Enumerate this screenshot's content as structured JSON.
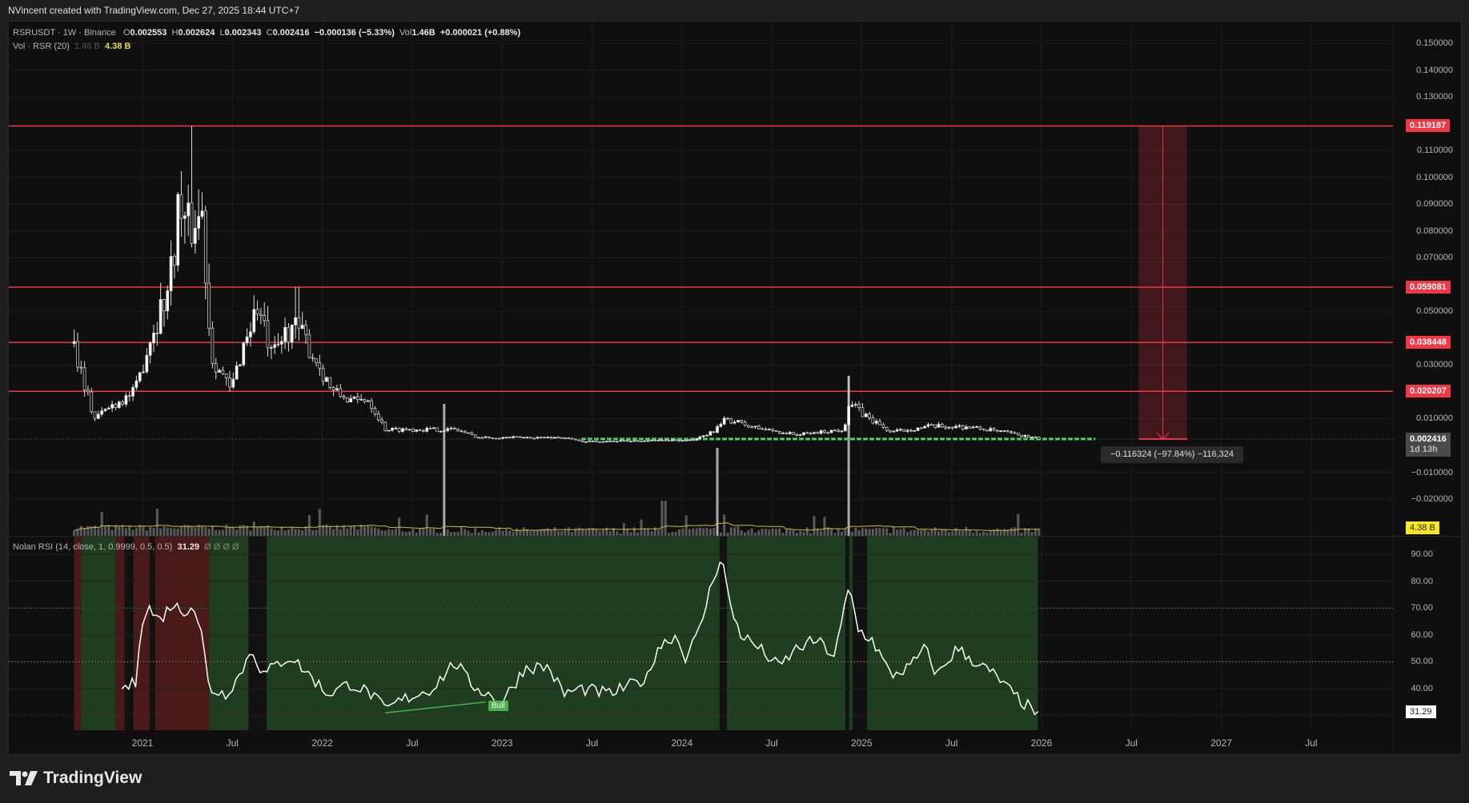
{
  "attribution": "NVincent created with TradingView.com, Dec 27, 2025 18:44 UTC+7",
  "legend": {
    "symbol": "RSRUSDT · 1W · Binance",
    "o_label": "O",
    "open": "0.002553",
    "h_label": "H",
    "high": "0.002624",
    "l_label": "L",
    "low": "0.002343",
    "c_label": "C",
    "close": "0.002416",
    "change": "−0.000136 (−5.33%)",
    "vol_label": "Vol",
    "vol": "1.46B",
    "change2": "+0.000021 (+0.88%)",
    "vol_indicator": "Vol · RSR (20)",
    "vol_value": "1.46 B",
    "vol_ma": "4.38 B"
  },
  "rsi_legend": {
    "name": "Nolan RSI (14, close, 1, 0.9999, 0.5, 0.5)",
    "value": "31.29",
    "extras": "Ø  Ø  Ø  Ø"
  },
  "colors": {
    "bg": "#0f0f0f",
    "level": "#f23645",
    "green_bg": "#1f3d1f",
    "red_bg": "#4a1a1a",
    "vol_ma": "#d4b83a"
  },
  "price_axis": [
    "0.150000",
    "0.140000",
    "0.130000",
    "0.110000",
    "0.100000",
    "0.090000",
    "0.080000",
    "0.070000",
    "0.050000",
    "0.030000",
    "0.010000",
    "−0.010000",
    "−0.020000"
  ],
  "price_axis_values": [
    0.15,
    0.14,
    0.13,
    0.11,
    0.1,
    0.09,
    0.08,
    0.07,
    0.05,
    0.03,
    0.01,
    -0.01,
    -0.02
  ],
  "levels": [
    {
      "label": "0.119187",
      "value": 0.119187
    },
    {
      "label": "0.059081",
      "value": 0.059081
    },
    {
      "label": "0.038448",
      "value": 0.038448
    },
    {
      "label": "0.020207",
      "value": 0.020207
    }
  ],
  "last_price": {
    "label": "0.002416",
    "value": 0.002416,
    "countdown": "1d 13h"
  },
  "vol_tag": "4.38 B",
  "measure": {
    "label": "−0.116324 (−97.84%) −116,324",
    "from": 0.119187,
    "to": 0.002416,
    "start": 2026.54,
    "end": 2026.81
  },
  "rsi_axis": [
    "90.00",
    "80.00",
    "70.00",
    "60.00",
    "50.00",
    "40.00"
  ],
  "rsi_axis_values": [
    90,
    80,
    70,
    60,
    50,
    40
  ],
  "rsi_tag": "31.29",
  "time_axis": [
    {
      "label": "2021",
      "t": 2021.0
    },
    {
      "label": "Jul",
      "t": 2021.5
    },
    {
      "label": "2022",
      "t": 2022.0
    },
    {
      "label": "Jul",
      "t": 2022.5
    },
    {
      "label": "2023",
      "t": 2023.0
    },
    {
      "label": "Jul",
      "t": 2023.5
    },
    {
      "label": "2024",
      "t": 2024.0
    },
    {
      "label": "Jul",
      "t": 2024.5
    },
    {
      "label": "2025",
      "t": 2025.0
    },
    {
      "label": "Jul",
      "t": 2025.5
    },
    {
      "label": "2026",
      "t": 2026.0
    },
    {
      "label": "Jul",
      "t": 2026.5
    },
    {
      "label": "2027",
      "t": 2027.0
    },
    {
      "label": "Jul",
      "t": 2027.5
    }
  ],
  "bull_label": "Bull",
  "logo": "TradingView",
  "chart_data": {
    "type": "candlestick",
    "price_keypoints": [
      [
        2020.62,
        0.038
      ],
      [
        2020.73,
        0.01
      ],
      [
        2020.83,
        0.015
      ],
      [
        2020.96,
        0.02
      ],
      [
        2021.04,
        0.04
      ],
      [
        2021.15,
        0.06
      ],
      [
        2021.2,
        0.09
      ],
      [
        2021.25,
        0.08
      ],
      [
        2021.33,
        0.088
      ],
      [
        2021.38,
        0.035
      ],
      [
        2021.49,
        0.02
      ],
      [
        2021.57,
        0.04
      ],
      [
        2021.64,
        0.052
      ],
      [
        2021.72,
        0.032
      ],
      [
        2021.82,
        0.045
      ],
      [
        2021.9,
        0.04
      ],
      [
        2021.98,
        0.03
      ],
      [
        2022.06,
        0.02
      ],
      [
        2022.19,
        0.016
      ],
      [
        2022.25,
        0.018
      ],
      [
        2022.35,
        0.006
      ],
      [
        2022.45,
        0.006
      ],
      [
        2022.74,
        0.006
      ],
      [
        2022.87,
        0.003
      ],
      [
        2023.34,
        0.003
      ],
      [
        2023.44,
        0.0015
      ],
      [
        2024.07,
        0.002
      ],
      [
        2024.17,
        0.005
      ],
      [
        2024.25,
        0.01
      ],
      [
        2024.38,
        0.007
      ],
      [
        2024.64,
        0.004
      ],
      [
        2024.9,
        0.006
      ],
      [
        2024.93,
        0.016
      ],
      [
        2025.0,
        0.012
      ],
      [
        2025.16,
        0.005
      ],
      [
        2025.37,
        0.007
      ],
      [
        2025.58,
        0.007
      ],
      [
        2025.79,
        0.005
      ],
      [
        2025.99,
        0.002416
      ]
    ],
    "spike_highs": [
      [
        2021.28,
        0.119187
      ],
      [
        2021.86,
        0.059081
      ],
      [
        2024.93,
        0.026
      ]
    ],
    "support_line": {
      "value": 0.002416,
      "start": 2023.44,
      "end": 2026.3
    },
    "rsi_keypoints": [
      [
        2020.885,
        40
      ],
      [
        2020.963,
        42
      ],
      [
        2020.99,
        65
      ],
      [
        2021.04,
        70
      ],
      [
        2021.09,
        65
      ],
      [
        2021.17,
        72
      ],
      [
        2021.22,
        68
      ],
      [
        2021.28,
        72
      ],
      [
        2021.33,
        60
      ],
      [
        2021.37,
        40
      ],
      [
        2021.46,
        38
      ],
      [
        2021.54,
        45
      ],
      [
        2021.61,
        55
      ],
      [
        2021.67,
        45
      ],
      [
        2021.77,
        50
      ],
      [
        2021.82,
        52
      ],
      [
        2021.93,
        45
      ],
      [
        2022.03,
        38
      ],
      [
        2022.16,
        42
      ],
      [
        2022.27,
        38
      ],
      [
        2022.35,
        32
      ],
      [
        2022.45,
        36
      ],
      [
        2022.61,
        40
      ],
      [
        2022.74,
        50
      ],
      [
        2022.82,
        42
      ],
      [
        2022.92,
        38
      ],
      [
        2023.0,
        35
      ],
      [
        2023.13,
        48
      ],
      [
        2023.26,
        48
      ],
      [
        2023.34,
        38
      ],
      [
        2023.44,
        40
      ],
      [
        2023.6,
        38
      ],
      [
        2023.81,
        44
      ],
      [
        2023.86,
        55
      ],
      [
        2023.96,
        60
      ],
      [
        2024.02,
        52
      ],
      [
        2024.09,
        60
      ],
      [
        2024.17,
        80
      ],
      [
        2024.22,
        90
      ],
      [
        2024.27,
        70
      ],
      [
        2024.33,
        60
      ],
      [
        2024.43,
        55
      ],
      [
        2024.54,
        48
      ],
      [
        2024.64,
        55
      ],
      [
        2024.75,
        58
      ],
      [
        2024.85,
        52
      ],
      [
        2024.93,
        78
      ],
      [
        2024.98,
        62
      ],
      [
        2025.06,
        58
      ],
      [
        2025.16,
        45
      ],
      [
        2025.27,
        48
      ],
      [
        2025.35,
        55
      ],
      [
        2025.42,
        45
      ],
      [
        2025.53,
        55
      ],
      [
        2025.63,
        50
      ],
      [
        2025.74,
        45
      ],
      [
        2025.84,
        38
      ],
      [
        2025.95,
        32
      ],
      [
        2025.99,
        31.29
      ]
    ],
    "rsi_regions": [
      [
        "red",
        2020.62,
        2020.66
      ],
      [
        "green",
        2020.66,
        2020.85
      ],
      [
        "red",
        2020.85,
        2020.9
      ],
      [
        "black",
        2020.9,
        2020.95
      ],
      [
        "red",
        2020.95,
        2021.04
      ],
      [
        "black",
        2021.04,
        2021.07
      ],
      [
        "red",
        2021.07,
        2021.37
      ],
      [
        "green",
        2021.37,
        2021.59
      ],
      [
        "black",
        2021.59,
        2021.69
      ],
      [
        "green",
        2021.69,
        2024.21
      ],
      [
        "black",
        2024.21,
        2024.25
      ],
      [
        "green",
        2024.25,
        2024.91
      ],
      [
        "black",
        2024.91,
        2024.93
      ],
      [
        "green",
        2024.93,
        2024.95
      ],
      [
        "black",
        2024.95,
        2025.03
      ],
      [
        "green",
        2025.03,
        2025.98
      ]
    ],
    "rsi_levels": [
      70,
      50,
      30
    ],
    "bull_divergence": [
      [
        2022.35,
        31
      ],
      [
        2022.91,
        35
      ]
    ],
    "volume_spikes": [
      [
        2024.93,
        1.0
      ],
      [
        2024.2,
        0.5
      ],
      [
        2022.68,
        0.3
      ],
      [
        2023.9,
        0.2
      ]
    ]
  }
}
